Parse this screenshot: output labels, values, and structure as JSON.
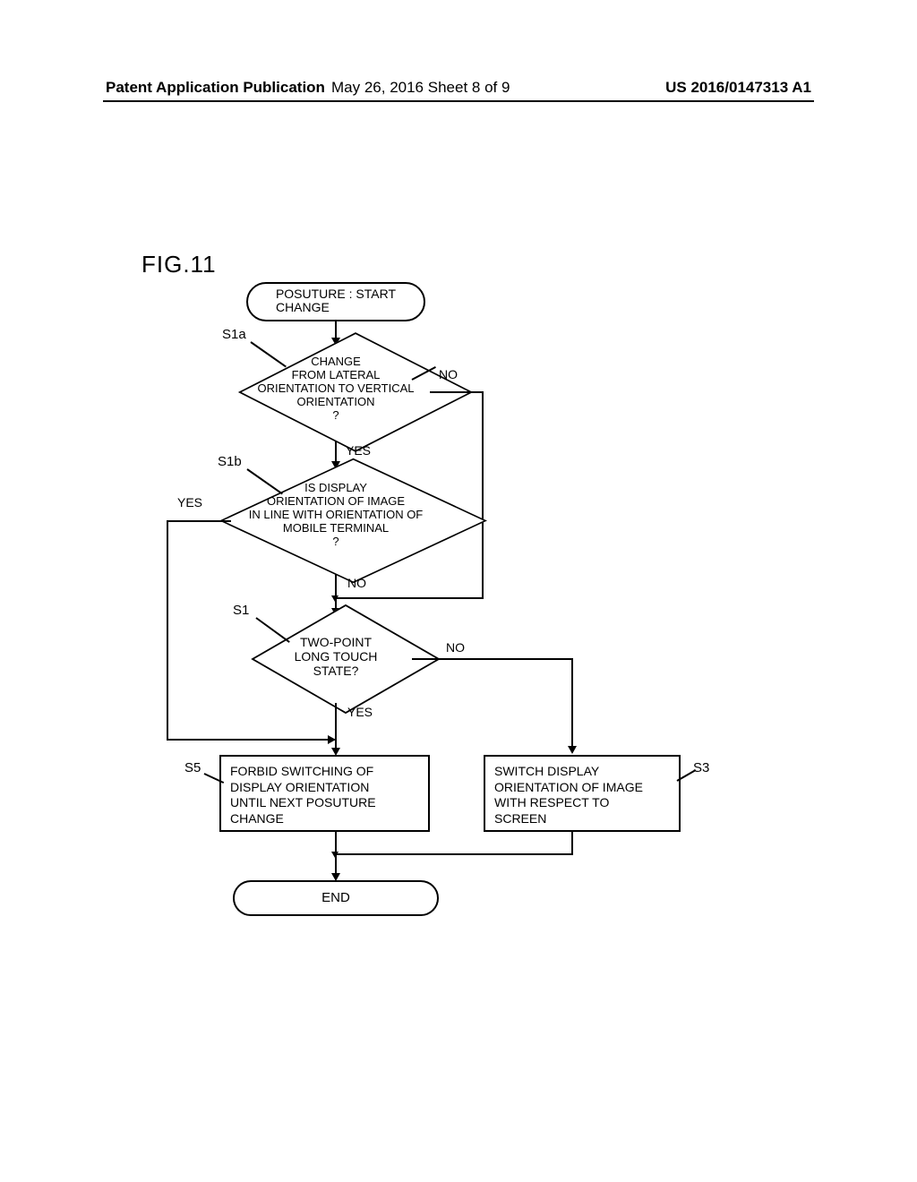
{
  "header": {
    "left": "Patent Application Publication",
    "center": "May 26, 2016  Sheet 8 of 9",
    "right": "US 2016/0147313 A1"
  },
  "figure_label": "FIG.11",
  "start": {
    "line1": "POSUTURE",
    "line2": "CHANGE",
    "start_token": ": START"
  },
  "steps": {
    "s1a": "S1a",
    "s1b": "S1b",
    "s1": "S1",
    "s3": "S3",
    "s5": "S5"
  },
  "decision_s1a": "CHANGE\nFROM LATERAL\nORIENTATION TO VERTICAL\nORIENTATION\n?",
  "decision_s1b": "IS DISPLAY\nORIENTATION OF IMAGE\nIN LINE WITH ORIENTATION OF\nMOBILE TERMINAL\n?",
  "decision_s1": "TWO-POINT\nLONG TOUCH\nSTATE?",
  "branch": {
    "yes": "YES",
    "no": "NO"
  },
  "process_s5": "FORBID SWITCHING OF\nDISPLAY ORIENTATION\nUNTIL NEXT POSUTURE\nCHANGE",
  "process_s3": "SWITCH DISPLAY\nORIENTATION OF IMAGE\nWITH RESPECT TO\nSCREEN",
  "end": "END",
  "chart_data": {
    "type": "flowchart",
    "nodes": [
      {
        "id": "start",
        "kind": "terminator",
        "label": "POSUTURE CHANGE : START"
      },
      {
        "id": "S1a",
        "kind": "decision",
        "label": "CHANGE FROM LATERAL ORIENTATION TO VERTICAL ORIENTATION ?"
      },
      {
        "id": "S1b",
        "kind": "decision",
        "label": "IS DISPLAY ORIENTATION OF IMAGE IN LINE WITH ORIENTATION OF MOBILE TERMINAL ?"
      },
      {
        "id": "S1",
        "kind": "decision",
        "label": "TWO-POINT LONG TOUCH STATE?"
      },
      {
        "id": "S5",
        "kind": "process",
        "label": "FORBID SWITCHING OF DISPLAY ORIENTATION UNTIL NEXT POSUTURE CHANGE"
      },
      {
        "id": "S3",
        "kind": "process",
        "label": "SWITCH DISPLAY ORIENTATION OF IMAGE WITH RESPECT TO SCREEN"
      },
      {
        "id": "end",
        "kind": "terminator",
        "label": "END"
      }
    ],
    "edges": [
      {
        "from": "start",
        "to": "S1a"
      },
      {
        "from": "S1a",
        "to": "S1b",
        "label": "YES"
      },
      {
        "from": "S1a",
        "to": "S1",
        "label": "NO"
      },
      {
        "from": "S1b",
        "to": "S1",
        "label": "NO"
      },
      {
        "from": "S1b",
        "to": "S5",
        "label": "YES"
      },
      {
        "from": "S1",
        "to": "S5",
        "label": "YES"
      },
      {
        "from": "S1",
        "to": "S3",
        "label": "NO"
      },
      {
        "from": "S5",
        "to": "end"
      },
      {
        "from": "S3",
        "to": "end"
      }
    ]
  }
}
